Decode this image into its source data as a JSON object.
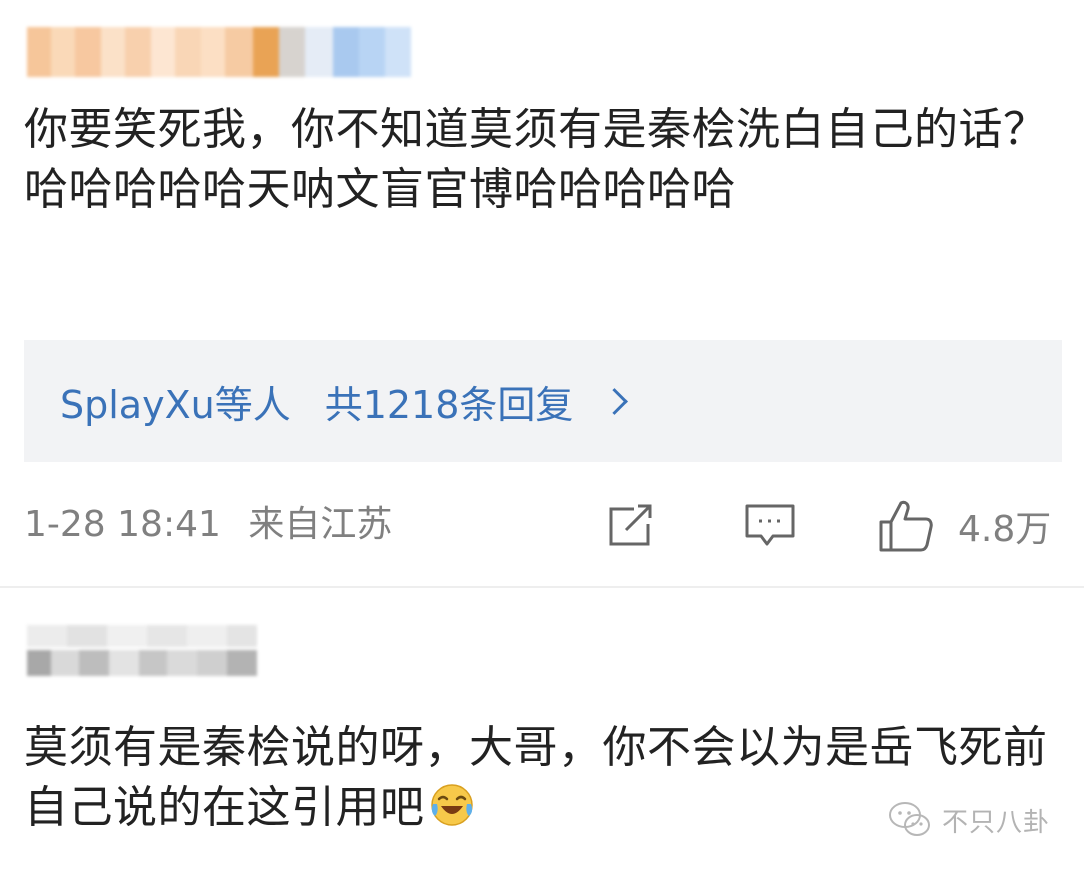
{
  "comments": [
    {
      "username": "",
      "text": "你要笑死我，你不知道莫须有是秦桧洗白自己的话？哈哈哈哈哈天呐文盲官博哈哈哈哈哈",
      "replies": {
        "users_label": "SplayXu等人",
        "count_label": "共1218条回复"
      },
      "meta": {
        "date": "1-28 18:41",
        "location": "来自江苏"
      },
      "actions": {
        "share_icon": "share-icon",
        "comment_icon": "comment-icon",
        "like_icon": "thumbs-up-icon",
        "like_count": "4.8万"
      }
    },
    {
      "username": "",
      "text": "莫须有是秦桧说的呀，大哥，你不会以为是岳飞死前自己说的在这引用吧",
      "emoji": "laugh-cry-emoji"
    }
  ],
  "watermark": {
    "icon": "wechat-icon",
    "text": "不只八卦"
  },
  "colors": {
    "link_blue": "#3a72b8",
    "reply_box_bg": "#f2f3f5",
    "meta_gray": "#808080",
    "text": "#222222"
  }
}
